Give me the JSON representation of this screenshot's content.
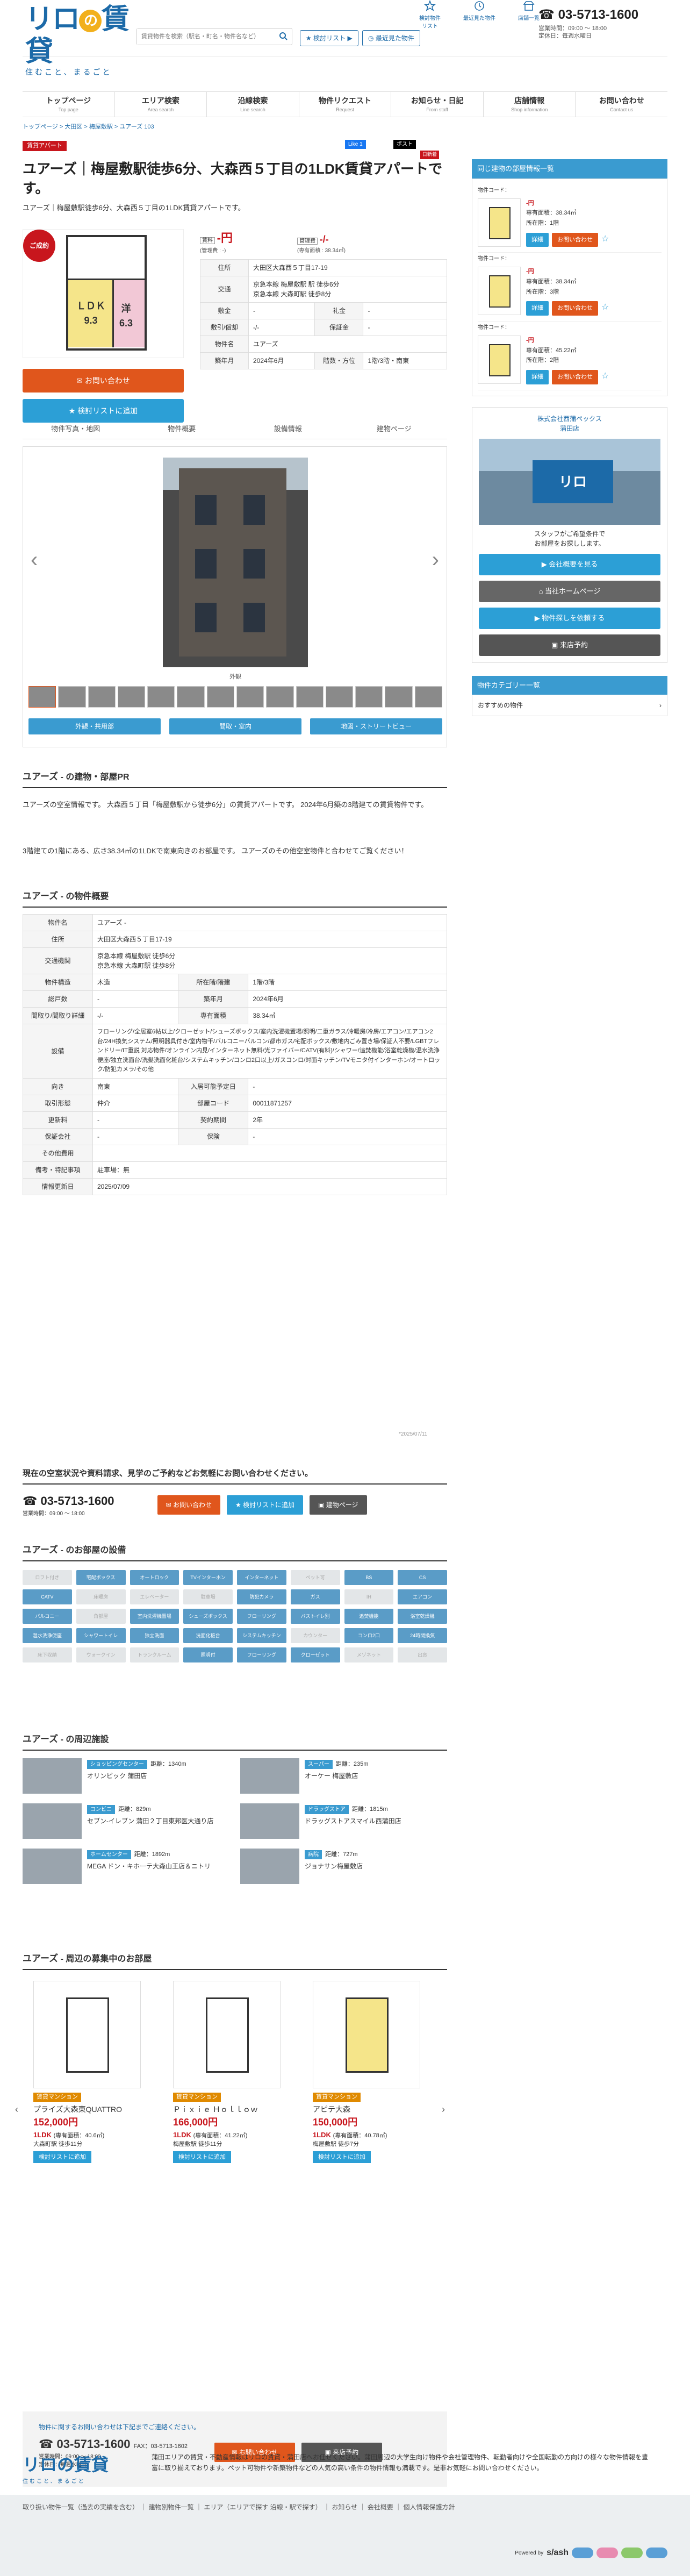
{
  "header": {
    "logo": "リロの賃貸",
    "logo_sub": "住むこと、まるごと",
    "search_placeholder": "賃貸物件を検索（駅名・町名・物件名など）",
    "btn_list": "検討リスト",
    "btn_recent": "最近見た物件",
    "icons": [
      {
        "label": "検討物件\nリスト"
      },
      {
        "label": "最近見た物件"
      },
      {
        "label": "店舗一覧"
      }
    ],
    "phone": "03-5713-1600",
    "hours": "営業時間：09:00 〜 18:00",
    "holiday": "定休日：毎週水曜日"
  },
  "nav": [
    {
      "ja": "トップページ",
      "en": "Top page"
    },
    {
      "ja": "エリア検索",
      "en": "Area search"
    },
    {
      "ja": "沿線検索",
      "en": "Line search"
    },
    {
      "ja": "物件リクエスト",
      "en": "Request"
    },
    {
      "ja": "お知らせ・日記",
      "en": "From staff"
    },
    {
      "ja": "店舗情報",
      "en": "Shop information"
    },
    {
      "ja": "お問い合わせ",
      "en": "Contact us"
    }
  ],
  "breadcrumb": "トップページ > 大田区 > 梅屋敷駅 > ユアーズ 103",
  "property": {
    "tag": "賃貸アパート",
    "title": "ユアーズ｜梅屋敷駅徒歩6分、大森西５丁目の1LDK賃貸アパートです。",
    "subtitle": "ユアーズ｜梅屋敷駅徒歩6分、大森西５丁目の1LDK賃貸アパートです。",
    "badge": "ご成約",
    "room_ldk": "ＬＤＫ\n9.3",
    "room_yo": "洋\n6.3",
    "btn_contact": "お問い合わせ",
    "btn_list": "検討リストに追加",
    "fb_like": "Like 1",
    "share": "ポスト",
    "label_rent": "賃料",
    "rent": "-円",
    "label_admin": "管理費",
    "admin": "-/-",
    "rent_note": "(管理費 : -)",
    "area_note": "(専有面積 : 38.34㎡)",
    "specs": [
      {
        "k": "住所",
        "v": "大田区大森西５丁目17-19"
      },
      {
        "k": "交通",
        "v": "京急本線 梅屋敷駅 駅 徒歩6分\n京急本線 大森町駅 徒歩8分"
      },
      {
        "k": "敷金",
        "v": "-",
        "k2": "礼金",
        "v2": "-"
      },
      {
        "k": "敷引/償却",
        "v": "-/-",
        "k2": "保証金",
        "v2": "-"
      },
      {
        "k": "物件名",
        "v": "ユアーズ"
      },
      {
        "k": "築年月",
        "v": "2024年6月",
        "k2": "階数・方位",
        "v2": "1階/3階・南東"
      }
    ],
    "tabs": [
      "物件写真・地図",
      "物件概要",
      "設備情報",
      "建物ページ"
    ],
    "gallery_caption": "外観",
    "gallery_btns": [
      "外観・共用部",
      "間取・室内",
      "地図・ストリートビュー"
    ]
  },
  "pr": {
    "heading_name": "ユアーズ",
    "heading": "の建物・部屋PR",
    "text1": "ユアーズの空室情報です。 大森西５丁目「梅屋敷駅から徒歩6分」の賃貸アパートです。 2024年6月築の3階建ての賃貸物件です。",
    "text2": "3階建ての1階にある、広さ38.34㎡の1LDKで南東向きのお部屋です。 ユアーズのその他空室物件と合わせてご覧ください！"
  },
  "gaiyo": {
    "heading_name": "ユアーズ",
    "heading": "の物件概要",
    "rows": [
      {
        "k": "物件名",
        "v": "ユアーズ -"
      },
      {
        "k": "住所",
        "v": "大田区大森西５丁目17-19"
      },
      {
        "k": "交通機関",
        "v": "京急本線 梅屋敷駅 徒歩6分\n京急本線 大森町駅 徒歩8分"
      },
      {
        "k": "物件構造",
        "v": "木造",
        "k2": "所在階/階建",
        "v2": "1階/3階"
      },
      {
        "k": "総戸数",
        "v": "-",
        "k2": "築年月",
        "v2": "2024年6月"
      },
      {
        "k": "間取り/間取り詳細",
        "v": "-/-",
        "k2": "専有面積",
        "v2": "38.34㎡"
      },
      {
        "k": "設備",
        "v": "フローリング/全居室6帖以上/クローゼット/シューズボックス/室内洗濯機置場/照明/二重ガラス/冷暖房/冷房/エアコン/エアコン2台/24H換気システム/照明器具付き/室内物干/バルコニーバルコン/都市ガス/宅配ボックス/敷地内ごみ置き場/保証人不要/LGBTフレンドリー/IT重説 対応物件/オンライン内見/インターネット無料/光ファイバー/CATV(有料)/シャワー/追焚機能/浴室乾燥機/温水洗浄便座/独立洗面台/洗髪洗面化粧台/システムキッチン/コンロ2口以上/ガスコンロ/対面キッチン/TVモニタ付インターホン/オートロック/防犯カメラ/その他"
      },
      {
        "k": "向き",
        "v": "南東",
        "k2": "入居可能予定日",
        "v2": "-"
      },
      {
        "k": "取引形態",
        "v": "仲介",
        "k2": "部屋コード",
        "v2": "00011871257"
      },
      {
        "k": "更新料",
        "v": "-",
        "k2": "契約期間",
        "v2": "2年"
      },
      {
        "k": "保証会社",
        "v": "-",
        "k2": "保険",
        "v2": "-"
      },
      {
        "k": "その他費用",
        "v": ""
      },
      {
        "k": "備考・特記事項",
        "v": "駐車場：無"
      },
      {
        "k": "情報更新日",
        "v": "2025/07/09"
      }
    ],
    "footnote": "*2025/07/11"
  },
  "contact": {
    "question": "現在の空室状況や資料請求、見学のご予約などお気軽にお問い合わせください。",
    "phone": "03-5713-1600",
    "hours": "営業時間：09:00 〜 18:00",
    "btn_contact": "お問い合わせ",
    "btn_list": "検討リストに追加",
    "btn_building": "建物ページ"
  },
  "equip": {
    "heading_name": "ユアーズ",
    "heading": "のお部屋の設備",
    "items": [
      {
        "t": "ロフト付き",
        "on": false
      },
      {
        "t": "宅配ボックス",
        "on": true
      },
      {
        "t": "オートロック",
        "on": true
      },
      {
        "t": "TVインターホン",
        "on": true
      },
      {
        "t": "インターネット",
        "on": true
      },
      {
        "t": "ペット可",
        "on": false
      },
      {
        "t": "BS",
        "on": true
      },
      {
        "t": "CS",
        "on": true
      },
      {
        "t": "CATV",
        "on": true
      },
      {
        "t": "床暖房",
        "on": false
      },
      {
        "t": "エレベーター",
        "on": false
      },
      {
        "t": "駐車場",
        "on": false
      },
      {
        "t": "防犯カメラ",
        "on": true
      },
      {
        "t": "ガス",
        "on": true
      },
      {
        "t": "IH",
        "on": false
      },
      {
        "t": "エアコン",
        "on": true
      },
      {
        "t": "バルコニー",
        "on": true
      },
      {
        "t": "角部屋",
        "on": false
      },
      {
        "t": "室内洗濯機置場",
        "on": true
      },
      {
        "t": "シューズボックス",
        "on": true
      },
      {
        "t": "フローリング",
        "on": true
      },
      {
        "t": "バストイレ別",
        "on": true
      },
      {
        "t": "追焚機能",
        "on": true
      },
      {
        "t": "浴室乾燥機",
        "on": true
      },
      {
        "t": "温水洗浄便座",
        "on": true
      },
      {
        "t": "シャワートイレ",
        "on": true
      },
      {
        "t": "独立洗面",
        "on": true
      },
      {
        "t": "洗面化粧台",
        "on": true
      },
      {
        "t": "システムキッチン",
        "on": true
      },
      {
        "t": "カウンター",
        "on": false
      },
      {
        "t": "コンロ2口",
        "on": true
      },
      {
        "t": "24時間換気",
        "on": true
      },
      {
        "t": "床下収納",
        "on": false
      },
      {
        "t": "ウォークイン",
        "on": false
      },
      {
        "t": "トランクルーム",
        "on": false
      },
      {
        "t": "照明付",
        "on": true
      },
      {
        "t": "フローリング",
        "on": true
      },
      {
        "t": "クローゼット",
        "on": true
      },
      {
        "t": "メゾネット",
        "on": false
      },
      {
        "t": "出窓",
        "on": false
      }
    ]
  },
  "around": {
    "heading_name": "ユアーズ",
    "heading": "の周辺施設",
    "items": [
      {
        "cat": "ショッピングセンター",
        "dist": "距離：1340m",
        "name": "オリンピック 蒲田店"
      },
      {
        "cat": "スーパー",
        "dist": "距離：235m",
        "name": "オーケー 梅屋敷店"
      },
      {
        "cat": "コンビニ",
        "dist": "距離：829m",
        "name": "セブン-イレブン 蒲田２丁目東邦医大通り店"
      },
      {
        "cat": "ドラッグストア",
        "dist": "距離：1815m",
        "name": "ドラッグストアスマイル西蒲田店"
      },
      {
        "cat": "ホームセンター",
        "dist": "距離：1892m",
        "name": "MEGA ドン・キホーテ大森山王店＆ニトリ"
      },
      {
        "cat": "病院",
        "dist": "距離：727m",
        "name": "ジョナサン梅屋敷店"
      }
    ]
  },
  "nearby": {
    "heading_name": "ユアーズ",
    "heading": "周辺の募集中のお部屋",
    "cards": [
      {
        "tag": "賃貸マンション",
        "name": "プライズ大森東QUATTRO",
        "price": "152,000円",
        "layout": "1LDK",
        "area": "(専有面積：40.6㎡)",
        "station": "大森町駅 徒歩11分",
        "btn": "検討リストに追加"
      },
      {
        "tag": "賃貸マンション",
        "name": "Ｐｉｘｉｅ Ｈｏｌｌｏｗ",
        "price": "166,000円",
        "layout": "1LDK",
        "area": "(専有面積：41.22㎡)",
        "station": "梅屋敷駅 徒歩11分",
        "btn": "検討リストに追加"
      },
      {
        "tag": "賃貸マンション",
        "name": "アピテ大森",
        "price": "150,000円",
        "layout": "1LDK",
        "area": "(専有面積：40.78㎡)",
        "station": "梅屋敷駅 徒歩7分",
        "btn": "検討リストに追加"
      }
    ]
  },
  "bottom": {
    "lead": "物件に関するお問い合わせは下記までご連絡ください。",
    "phone": "03-5713-1600",
    "fax": "FAX：03-5713-1602",
    "hours": "営業時間：09:00 〜 18:00",
    "holiday": "定休日：毎週水曜日",
    "btn_contact": "お問い合わせ",
    "btn_visit": "来店予約"
  },
  "sidebar": {
    "same_building": "同じ建物の部屋情報一覧",
    "rooms": [
      {
        "label": "物件コード：",
        "price": "-円",
        "area": "専有面積：38.34㎡",
        "floor": "所在階：1階"
      },
      {
        "label": "物件コード：",
        "price": "-円",
        "area": "専有面積：38.34㎡",
        "floor": "所在階：3階"
      },
      {
        "label": "物件コード：",
        "price": "-円",
        "area": "専有面積：45.22㎡",
        "floor": "所在階：2階"
      }
    ],
    "btn_detail": "詳細",
    "btn_contact": "お問い合わせ",
    "shop_name": "株式会社西蒲ペックス\n蒲田店",
    "shop_msg": "スタッフがご希望条件で\nお部屋をお探しします。",
    "btn_company": "会社概要を見る",
    "btn_home": "当社ホームページ",
    "btn_request": "物件探しを依頼する",
    "btn_visit": "来店予約",
    "category": "物件カテゴリー一覧",
    "recommend": "おすすめの物件"
  },
  "footer": {
    "logo": "リロの賃貸",
    "text": "蒲田エリアの賃貸・不動産情報はリロの賃貸・蒲田店へお任せください。蒲田周辺の大学生向け物件や会社管理物件、転勤者向けや全国転勤の方向けの様々な物件情報を豊富に取り揃えております。ペット可物件や新築物件などの人気の高い条件の物件情報も満載です。是非お気軽にお問い合わせください。",
    "links": "取り扱い物件一覧（過去の実績を含む） ｜ 建物別物件一覧 ｜ エリア（エリアで探す 沿線・駅で探す） ｜ お知らせ ｜ 会社概要 ｜ 個人情報保護方針",
    "powered": "Powered by"
  }
}
